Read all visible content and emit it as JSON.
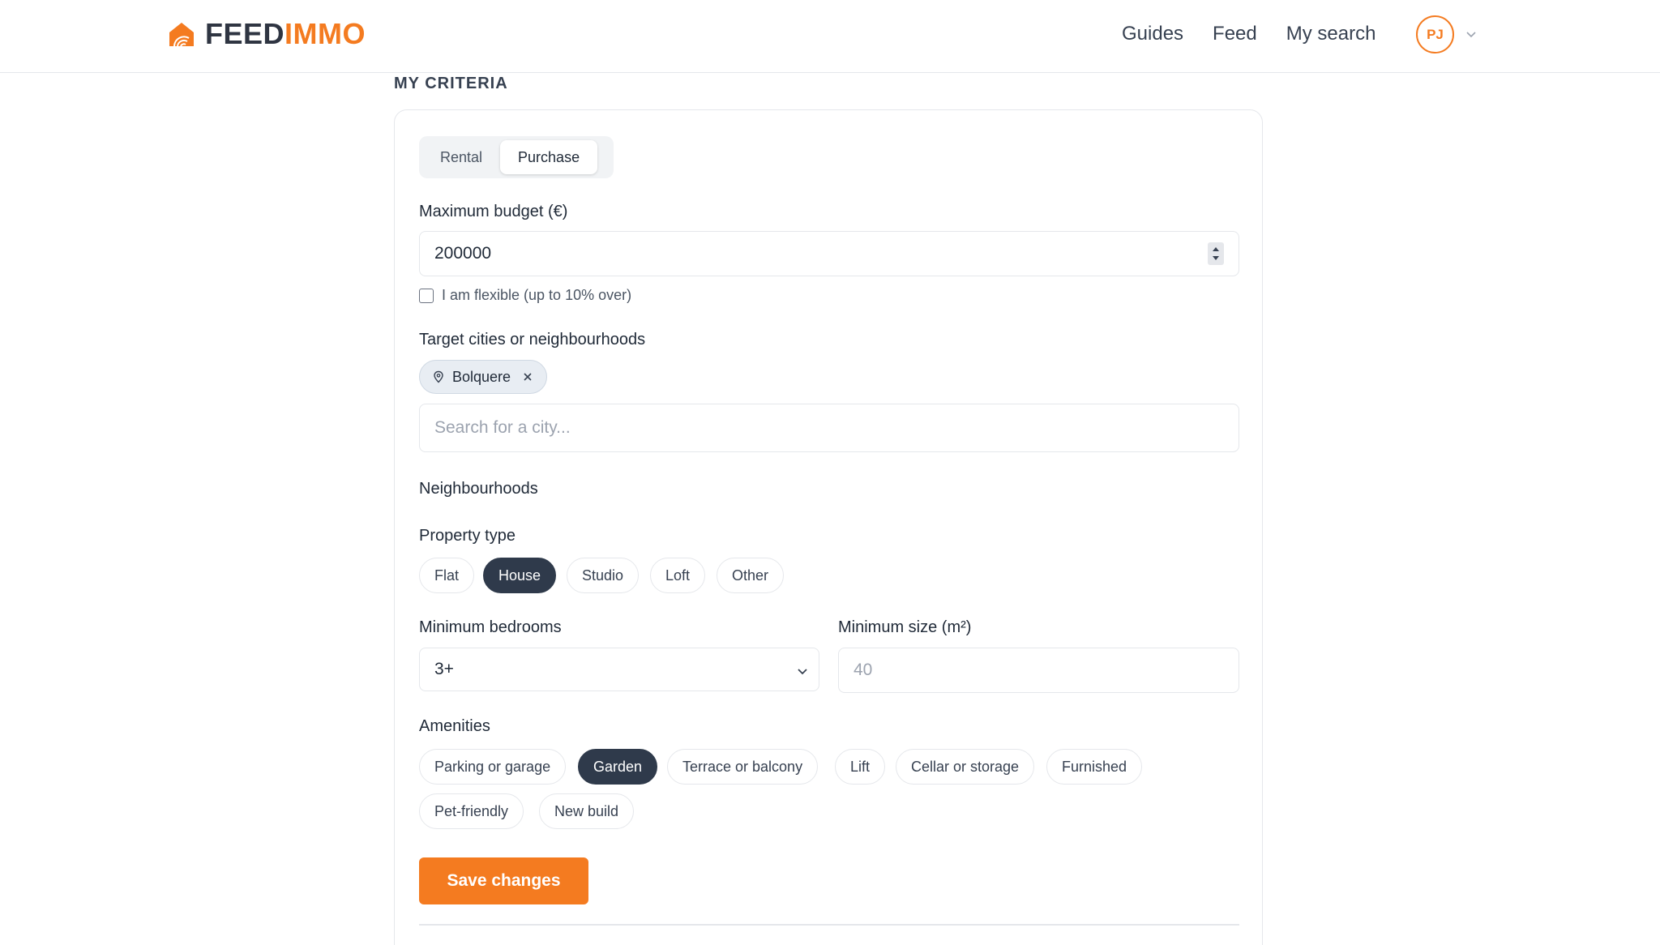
{
  "header": {
    "logo_part1": "FEED",
    "logo_part2": "IMMO",
    "nav": [
      "Guides",
      "Feed",
      "My search"
    ],
    "avatar_initials": "PJ"
  },
  "section_title": "MY CRITERIA",
  "transaction_tabs": {
    "options": [
      "Rental",
      "Purchase"
    ],
    "selected": "Purchase"
  },
  "budget": {
    "label": "Maximum budget (€)",
    "value": "200000",
    "flexible_label": "I am flexible (up to 10% over)",
    "flexible_checked": false
  },
  "cities": {
    "label": "Target cities or neighbourhoods",
    "tags": [
      "Bolquere"
    ],
    "placeholder": "Search for a city..."
  },
  "neighbourhoods_label": "Neighbourhoods",
  "property_type": {
    "label": "Property type",
    "options": [
      "Flat",
      "House",
      "Studio",
      "Loft",
      "Other"
    ],
    "selected": [
      "House"
    ]
  },
  "min_bedrooms": {
    "label": "Minimum bedrooms",
    "value": "3+"
  },
  "min_size": {
    "label": "Minimum size (m²)",
    "placeholder": "40"
  },
  "amenities": {
    "label": "Amenities",
    "options": [
      "Parking or garage",
      "Garden",
      "Terrace or balcony",
      "Lift",
      "Cellar or storage",
      "Furnished",
      "Pet-friendly",
      "New build"
    ],
    "selected": [
      "Garden"
    ]
  },
  "save_label": "Save changes",
  "colors": {
    "accent": "#f47b20",
    "selected_chip": "#2f3a4b"
  },
  "icons": {
    "logo": "house-logo-icon",
    "avatar_menu": "chevron-down-icon",
    "tag": "location-pin-icon",
    "tag_remove": "close-icon",
    "select": "chevron-down-icon",
    "stepper": "stepper-arrows-icon"
  }
}
